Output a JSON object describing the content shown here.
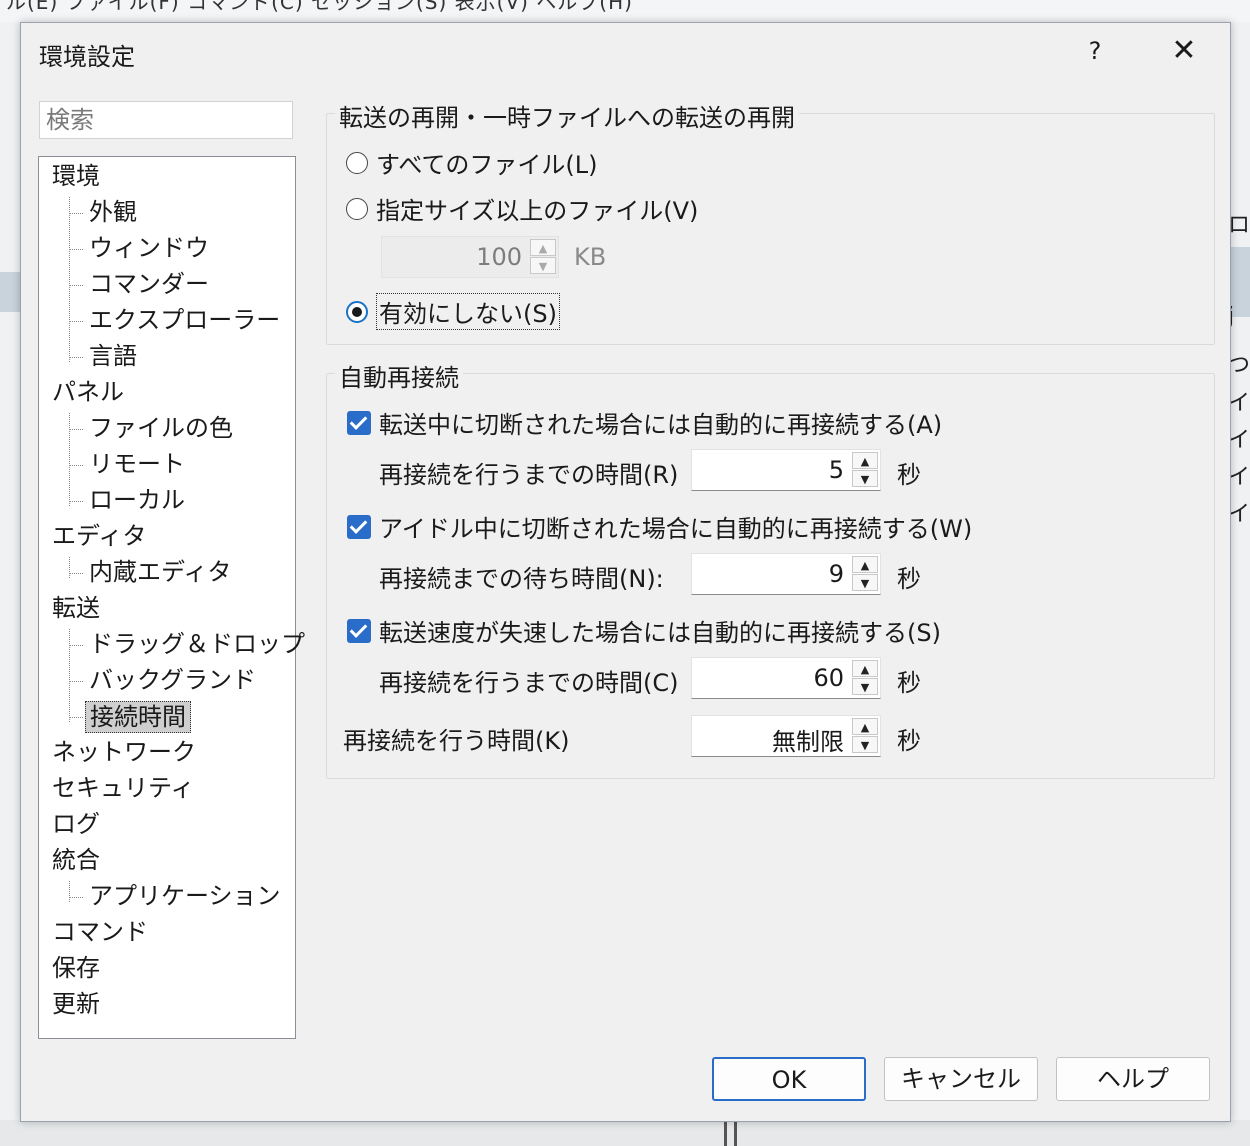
{
  "background": {
    "menu_fragment": "ル(E)  ファイル(F)  コマンド(C)  セッション(S)  表示(V)  ヘルプ(H)",
    "right_fragments": [
      "ロ/",
      "j",
      "つ",
      "イ|",
      "イ|",
      "イ|",
      "イ|"
    ]
  },
  "dialog": {
    "title": "環境設定",
    "help_label": "?",
    "close_label": "✕"
  },
  "search": {
    "placeholder": "検索"
  },
  "tree": {
    "items": [
      {
        "label": "環境"
      },
      {
        "label": "外観"
      },
      {
        "label": "ウィンドウ"
      },
      {
        "label": "コマンダー"
      },
      {
        "label": "エクスプローラー"
      },
      {
        "label": "言語"
      },
      {
        "label": "パネル"
      },
      {
        "label": "ファイルの色"
      },
      {
        "label": "リモート"
      },
      {
        "label": "ローカル"
      },
      {
        "label": "エディタ"
      },
      {
        "label": "内蔵エディタ"
      },
      {
        "label": "転送"
      },
      {
        "label": "ドラッグ＆ドロップ"
      },
      {
        "label": "バックグランド"
      },
      {
        "label": "接続時間"
      },
      {
        "label": "ネットワーク"
      },
      {
        "label": "セキュリティ"
      },
      {
        "label": "ログ"
      },
      {
        "label": "統合"
      },
      {
        "label": "アプリケーション"
      },
      {
        "label": "コマンド"
      },
      {
        "label": "保存"
      },
      {
        "label": "更新"
      }
    ],
    "selected": "接続時間"
  },
  "resume": {
    "title": "転送の再開・一時ファイルへの転送の再開",
    "opt_all": "すべてのファイル(L)",
    "opt_size": "指定サイズ以上のファイル(V)",
    "size_value": "100",
    "size_unit": "KB",
    "opt_disable": "有効にしない(S)",
    "selected_option": "有効にしない(S)"
  },
  "reconnect": {
    "title": "自動再接続",
    "cb1_label": "転送中に切断された場合には自動的に再接続する(A)",
    "cb1_checked": true,
    "delay1_label": "再接続を行うまでの時間(R)",
    "delay1_value": "5",
    "cb2_label": "アイドル中に切断された場合に自動的に再接続する(W)",
    "cb2_checked": true,
    "delay2_label": "再接続までの待ち時間(N):",
    "delay2_value": "9",
    "cb3_label": "転送速度が失速した場合には自動的に再接続する(S)",
    "cb3_checked": true,
    "delay3_label": "再接続を行うまでの時間(C)",
    "delay3_value": "60",
    "total_label": "再接続を行う時間(K)",
    "total_value": "無制限",
    "unit_sec": "秒"
  },
  "buttons": {
    "ok": "OK",
    "cancel": "キャンセル",
    "help": "ヘルプ"
  },
  "colors": {
    "accent": "#2a6dc8",
    "dialog_bg": "#f0f0f0",
    "selection_bg": "#cfcfcf"
  }
}
